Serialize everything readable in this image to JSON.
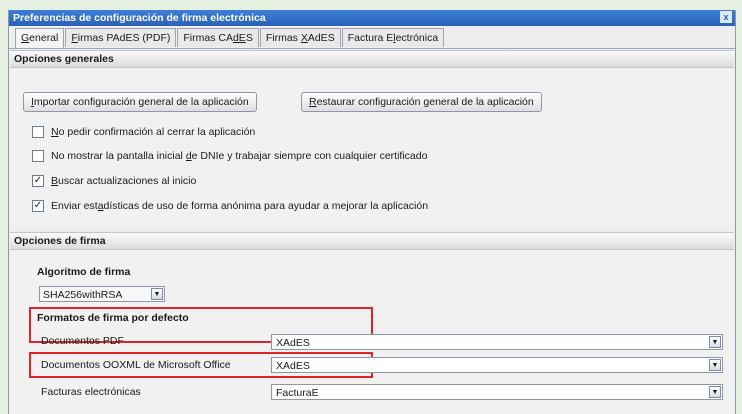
{
  "window": {
    "title": "Preferencias de configuración de firma electrónica",
    "close_glyph": "x"
  },
  "tabs": [
    {
      "pre": "",
      "u": "G",
      "post": "eneral"
    },
    {
      "pre": "",
      "u": "F",
      "post": "irmas PAdES (PDF)"
    },
    {
      "pre": "Firmas CA",
      "u": "dE",
      "post": "S"
    },
    {
      "pre": "Firmas ",
      "u": "X",
      "post": "AdES"
    },
    {
      "pre": "Factura E",
      "u": "l",
      "post": "ectrónica"
    }
  ],
  "general": {
    "header": "Opciones generales",
    "import_button": {
      "pre": "",
      "u": "I",
      "post": "mportar configuración general de la aplicación"
    },
    "restore_button": {
      "pre": "",
      "u": "R",
      "post": "estaurar configuración general de la aplicación"
    },
    "checkboxes": [
      {
        "pre": "",
        "u": "N",
        "post": "o pedir confirmación al cerrar la aplicación",
        "checked": false
      },
      {
        "pre": "No mostrar la pantalla inicial ",
        "u": "d",
        "post": "e DNIe y trabajar siempre con cualquier certificado",
        "checked": false
      },
      {
        "pre": "",
        "u": "B",
        "post": "uscar actualizaciones al inicio",
        "checked": true
      },
      {
        "pre": "Enviar est",
        "u": "a",
        "post": "dísticas de uso de forma anónima para ayudar a mejorar la aplicación",
        "checked": true
      }
    ]
  },
  "signature": {
    "header": "Opciones de firma",
    "algorithm_label": "Algoritmo de firma",
    "algorithm_value": "SHA256withRSA",
    "formats_label": "Formatos de firma por defecto",
    "rows": [
      {
        "label": "Documentos PDF",
        "value": "XAdES"
      },
      {
        "label": "Documentos OOXML de Microsoft Office",
        "value": "XAdES"
      },
      {
        "label": "Facturas electrónicas",
        "value": "FacturaE"
      }
    ]
  },
  "colors": {
    "highlight": "#e0262b",
    "titlebar": "#2a62b8"
  },
  "glyphs": {
    "check": "✓",
    "down": "▼"
  }
}
